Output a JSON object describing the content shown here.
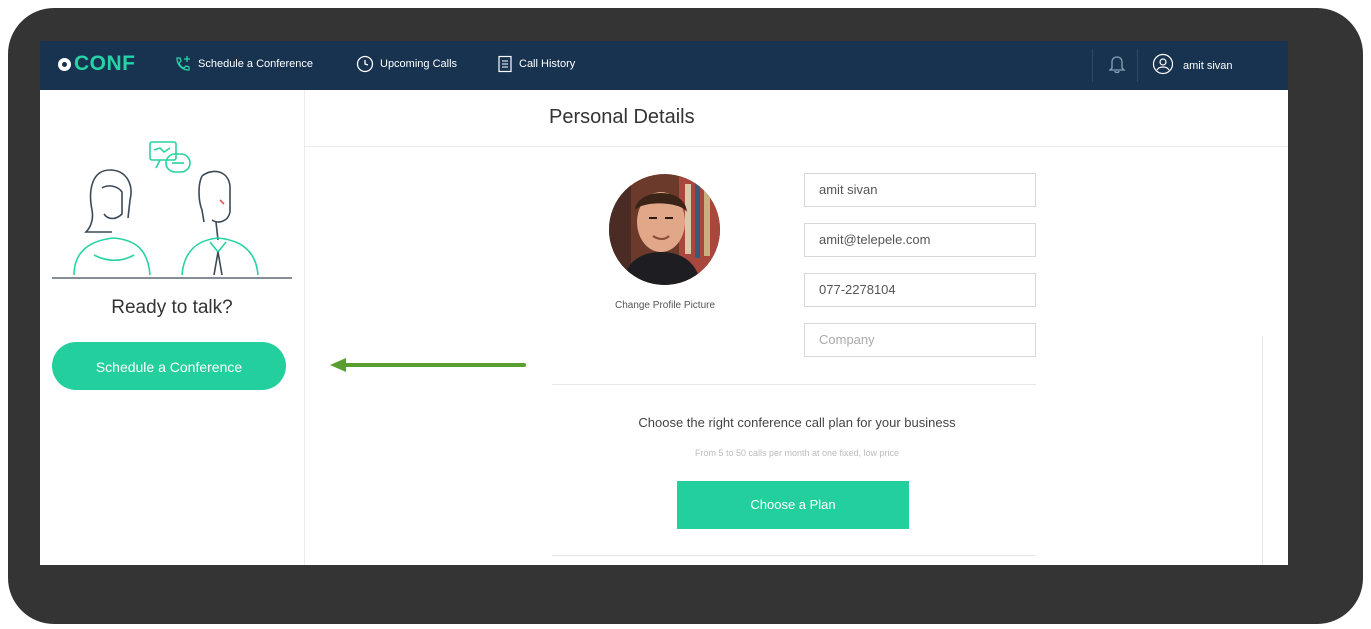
{
  "app": {
    "logo": "CONF"
  },
  "nav": {
    "schedule": "Schedule a Conference",
    "upcoming": "Upcoming Calls",
    "history": "Call History",
    "user_name": "amit sivan"
  },
  "sidebar": {
    "ready_text": "Ready to talk?",
    "schedule_button": "Schedule a Conference"
  },
  "main": {
    "title": "Personal Details",
    "change_picture": "Change Profile Picture",
    "fields": {
      "name": "amit sivan",
      "email": "amit@telepele.com",
      "phone": "077-2278104",
      "company_placeholder": "Company"
    },
    "plan_text": "Choose the right conference call plan for your business",
    "plan_sub": "From 5 to 50 calls per month at one fixed, low price",
    "plan_button": "Choose a Plan"
  },
  "colors": {
    "navbar": "#173350",
    "accent": "#22cf9d",
    "frame": "#343434",
    "arrow": "#5a9e2f"
  }
}
